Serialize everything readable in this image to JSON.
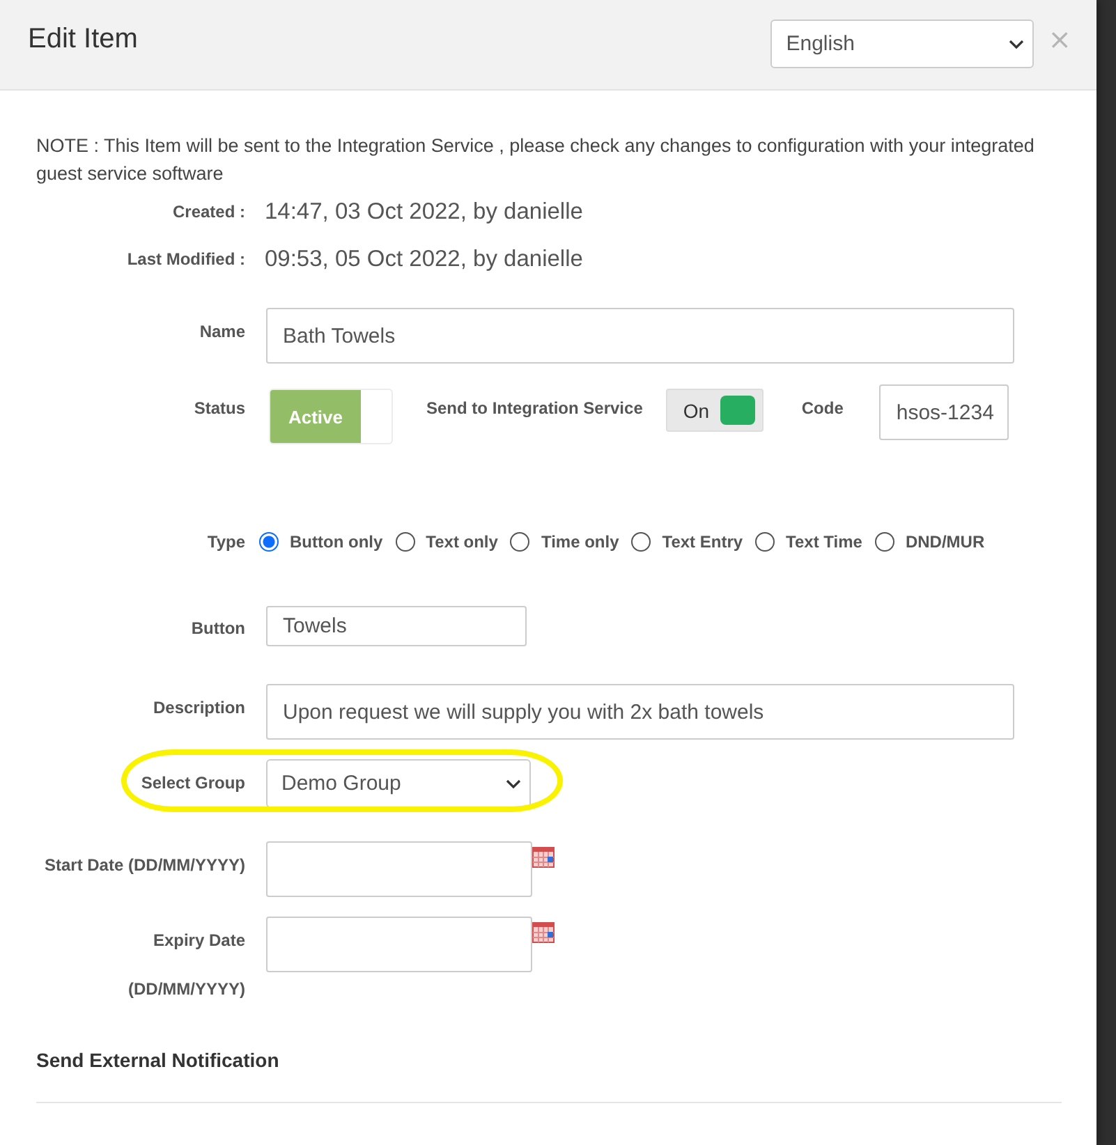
{
  "dialog": {
    "title": "Edit Item",
    "language": "English",
    "close": "×"
  },
  "note": "NOTE : This Item will be sent to the Integration Service , please check any changes to configuration with your integrated guest service software",
  "meta": [
    {
      "label": "Created :",
      "value": "14:47, 03 Oct 2022, by danielle"
    },
    {
      "label": "Last Modified :",
      "value": "09:53, 05 Oct 2022, by danielle"
    }
  ],
  "name": {
    "label": "Name",
    "value": "Bath Towels"
  },
  "status": {
    "label": "Status",
    "state_label": "Active",
    "on": true
  },
  "integration": {
    "label": "Send to Integration Service",
    "state_label": "On",
    "on": true
  },
  "code": {
    "label": "Code",
    "value": "hsos-1234"
  },
  "type": {
    "label": "Type",
    "options": [
      {
        "label": "Button only",
        "selected": true
      },
      {
        "label": "Text only",
        "selected": false
      },
      {
        "label": "Time only",
        "selected": false
      },
      {
        "label": "Text Entry",
        "selected": false
      },
      {
        "label": "Text Time",
        "selected": false
      },
      {
        "label": "DND/MUR",
        "selected": false
      }
    ]
  },
  "button": {
    "label": "Button",
    "value": "Towels"
  },
  "description": {
    "label": "Description",
    "value": "Upon request we will supply you with 2x bath towels"
  },
  "group": {
    "label": "Select Group",
    "value": "Demo Group",
    "highlighted": true
  },
  "start_date": {
    "label": "Start Date (DD/MM/YYYY)"
  },
  "expiry_date": {
    "label": "Expiry Date (DD/MM/YYYY)"
  },
  "section_title": "Send External Notification"
}
